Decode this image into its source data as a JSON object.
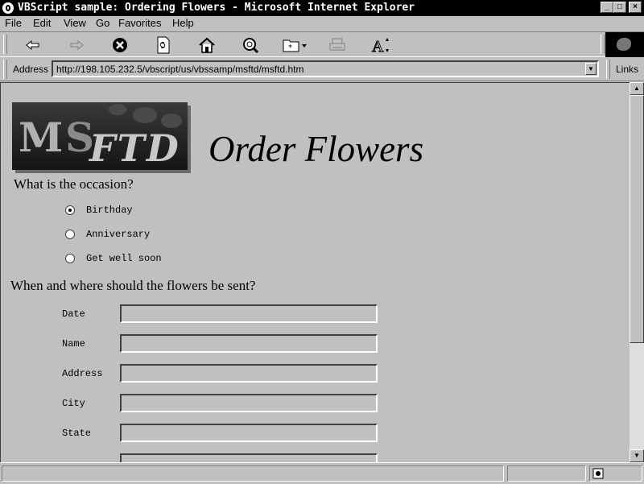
{
  "window": {
    "title": "VBScript sample:  Ordering Flowers - Microsoft Internet Explorer",
    "controls": {
      "minimize": "_",
      "maximize": "□",
      "close": "×"
    }
  },
  "menu": {
    "items": [
      {
        "label": "File"
      },
      {
        "label": "Edit"
      },
      {
        "label": "View"
      },
      {
        "label": "Go"
      },
      {
        "label": "Favorites"
      },
      {
        "label": "Help"
      }
    ]
  },
  "toolbar": {
    "buttons": [
      "back-icon",
      "forward-icon",
      "stop-icon",
      "refresh-icon",
      "home-icon",
      "search-icon",
      "favorites-icon",
      "print-icon",
      "font-icon"
    ]
  },
  "address_bar": {
    "label": "Address",
    "url": "http://198.105.232.5/vbscript/us/vbssamp/msftd/msftd.htm",
    "links_label": "Links"
  },
  "page": {
    "logo": {
      "m": "M",
      "s": "S",
      "ftd": "FTD"
    },
    "title": "Order Flowers",
    "occasion_question": "What is the occasion?",
    "occasions": [
      {
        "label": "Birthday",
        "checked": true
      },
      {
        "label": "Anniversary",
        "checked": false
      },
      {
        "label": "Get well soon",
        "checked": false
      }
    ],
    "delivery_question": "When and where should the flowers be sent?",
    "fields": [
      {
        "label": "Date",
        "value": ""
      },
      {
        "label": "Name",
        "value": ""
      },
      {
        "label": "Address",
        "value": ""
      },
      {
        "label": "City",
        "value": ""
      },
      {
        "label": "State",
        "value": ""
      }
    ]
  },
  "colors": {
    "chrome": "#c0c0c0",
    "titlebar": "#000000"
  }
}
